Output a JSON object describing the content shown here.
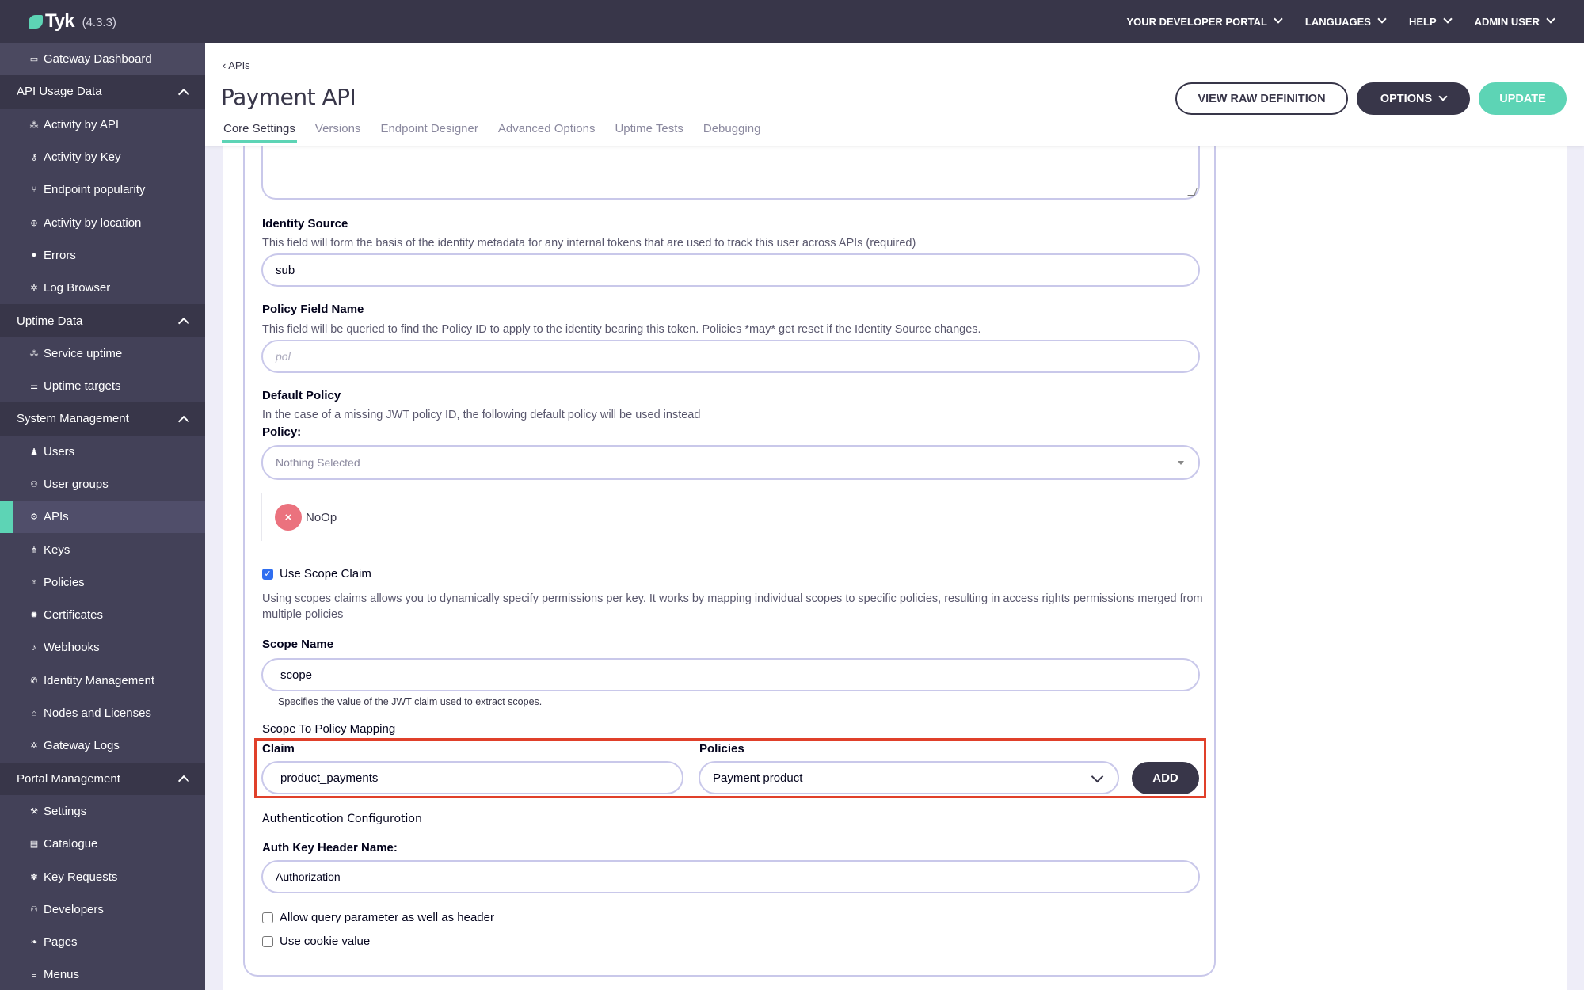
{
  "topbar": {
    "brand": "Tyk",
    "version": "(4.3.3)",
    "nav": [
      {
        "label": "YOUR DEVELOPER PORTAL"
      },
      {
        "label": "LANGUAGES"
      },
      {
        "label": "HELP"
      },
      {
        "label": "ADMIN USER"
      }
    ]
  },
  "sidebar": {
    "top_item": {
      "label": "Gateway Dashboard",
      "icon": "monitor-icon"
    },
    "sections": [
      {
        "title": "API Usage Data",
        "items": [
          {
            "label": "Activity by API",
            "icon": "cubes-icon",
            "glyph": "⁂"
          },
          {
            "label": "Activity by Key",
            "icon": "key-icon",
            "glyph": "⚷"
          },
          {
            "label": "Endpoint popularity",
            "icon": "branch-icon",
            "glyph": "⑂"
          },
          {
            "label": "Activity by location",
            "icon": "globe-icon",
            "glyph": "⊕"
          },
          {
            "label": "Errors",
            "icon": "bomb-icon",
            "glyph": "●"
          },
          {
            "label": "Log Browser",
            "icon": "bug-icon",
            "glyph": "✲"
          }
        ]
      },
      {
        "title": "Uptime Data",
        "items": [
          {
            "label": "Service uptime",
            "icon": "cubes-icon",
            "glyph": "⁂"
          },
          {
            "label": "Uptime targets",
            "icon": "list-icon",
            "glyph": "☰"
          }
        ]
      },
      {
        "title": "System Management",
        "items": [
          {
            "label": "Users",
            "icon": "user-icon",
            "glyph": "♟"
          },
          {
            "label": "User groups",
            "icon": "users-icon",
            "glyph": "⚇"
          },
          {
            "label": "APIs",
            "icon": "cogs-icon",
            "glyph": "⚙",
            "active": true
          },
          {
            "label": "Keys",
            "icon": "sitemap-icon",
            "glyph": "⋔"
          },
          {
            "label": "Policies",
            "icon": "plug-icon",
            "glyph": "♆"
          },
          {
            "label": "Certificates",
            "icon": "certificate-icon",
            "glyph": "✹"
          },
          {
            "label": "Webhooks",
            "icon": "bell-icon",
            "glyph": "♪"
          },
          {
            "label": "Identity Management",
            "icon": "phone-icon",
            "glyph": "✆"
          },
          {
            "label": "Nodes and Licenses",
            "icon": "bank-icon",
            "glyph": "⌂"
          },
          {
            "label": "Gateway Logs",
            "icon": "bug-icon",
            "glyph": "✲"
          }
        ]
      },
      {
        "title": "Portal Management",
        "items": [
          {
            "label": "Settings",
            "icon": "wrench-icon",
            "glyph": "⚒"
          },
          {
            "label": "Catalogue",
            "icon": "book-icon",
            "glyph": "▤"
          },
          {
            "label": "Key Requests",
            "icon": "paw-icon",
            "glyph": "✽"
          },
          {
            "label": "Developers",
            "icon": "users-icon",
            "glyph": "⚇"
          },
          {
            "label": "Pages",
            "icon": "leaf-icon",
            "glyph": "❧"
          },
          {
            "label": "Menus",
            "icon": "bars-icon",
            "glyph": "≡"
          }
        ]
      }
    ]
  },
  "header": {
    "breadcrumb": "‹ APIs",
    "title": "Payment API",
    "tabs": [
      {
        "label": "Core Settings",
        "active": true
      },
      {
        "label": "Versions"
      },
      {
        "label": "Endpoint Designer"
      },
      {
        "label": "Advanced Options"
      },
      {
        "label": "Uptime Tests"
      },
      {
        "label": "Debugging"
      }
    ],
    "buttons": {
      "view_raw": "VIEW RAW DEFINITION",
      "options": "OPTIONS",
      "update": "UPDATE"
    }
  },
  "form": {
    "identity_source": {
      "label": "Identity Source",
      "help": "This field will form the basis of the identity metadata for any internal tokens that are used to track this user across APIs (required)",
      "value": "sub"
    },
    "policy_field_name": {
      "label": "Policy Field Name",
      "help": "This field will be queried to find the Policy ID to apply to the identity bearing this token. Policies *may* get reset if the Identity Source changes.",
      "placeholder": "pol"
    },
    "default_policy": {
      "label": "Default Policy",
      "help": "In the case of a missing JWT policy ID, the following default policy will be used instead",
      "policy_label": "Policy:",
      "select_value": "Nothing Selected",
      "chips": [
        {
          "label": "NoOp",
          "remove": "×"
        }
      ]
    },
    "use_scope_claim": {
      "label": "Use Scope Claim",
      "checked": true,
      "help": "Using scopes claims allows you to dynamically specify permissions per key. It works by mapping individual scopes to specific policies, resulting in access rights permissions merged from multiple policies"
    },
    "scope_name": {
      "label": "Scope Name",
      "value": "scope",
      "help": "Specifies the value of the JWT claim used to extract scopes."
    },
    "scope_mapping": {
      "title": "Scope To Policy Mapping",
      "claim_label": "Claim",
      "claim_value": "product_payments",
      "policies_label": "Policies",
      "policies_value": "Payment product",
      "add_label": "ADD"
    },
    "auth_config": {
      "title": "Authenticotion Configurotion",
      "header_label": "Auth Key Header Name:",
      "header_value": "Authorization",
      "allow_query": {
        "label": "Allow query parameter as well as header",
        "checked": false
      },
      "use_cookie": {
        "label": "Use cookie value",
        "checked": false
      }
    }
  }
}
